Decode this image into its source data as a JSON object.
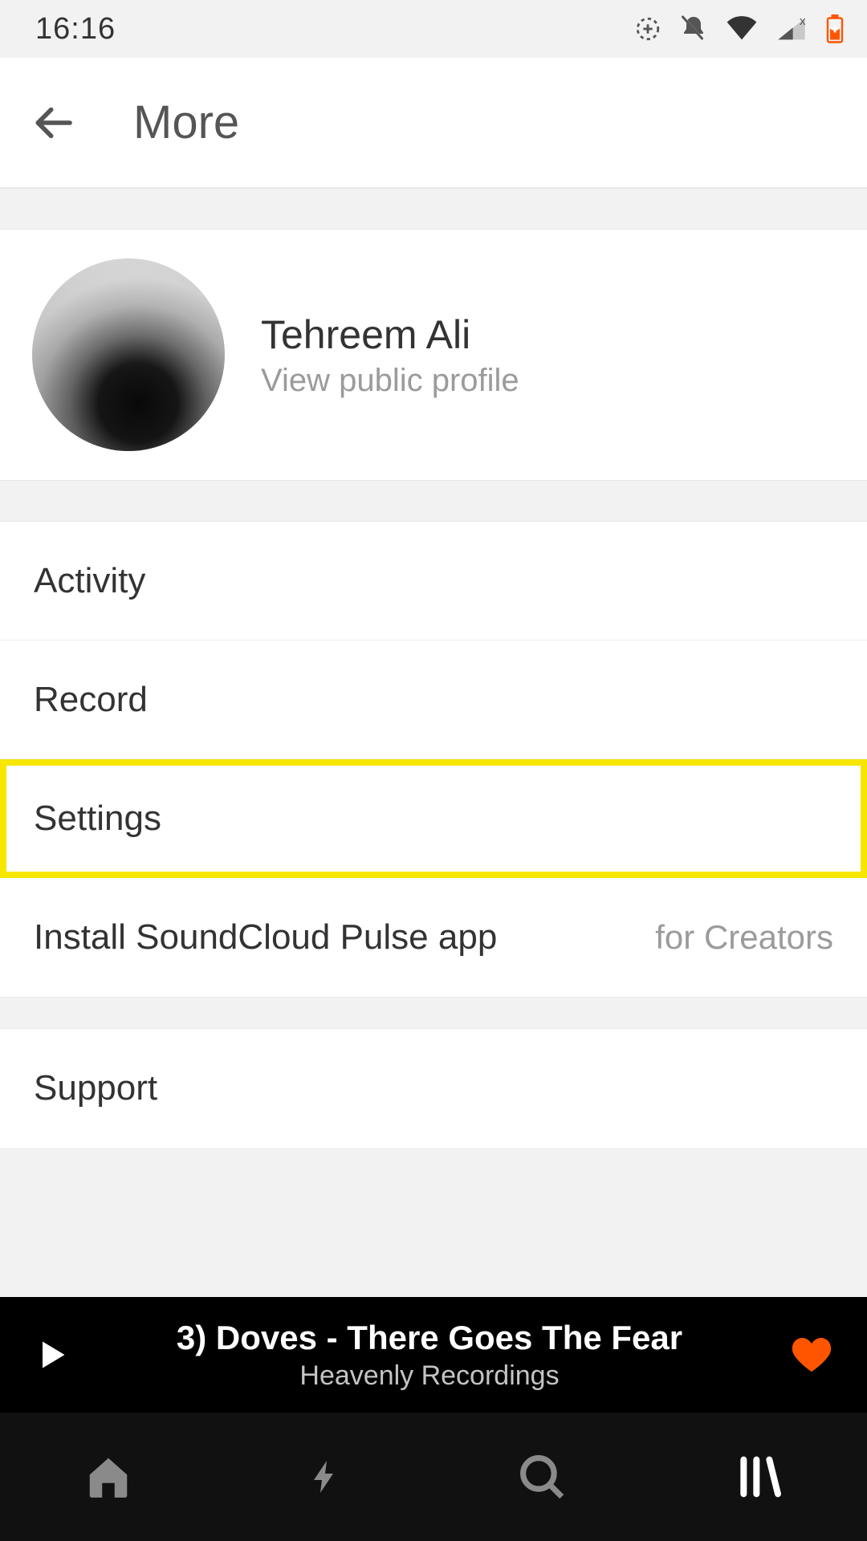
{
  "status": {
    "time": "16:16"
  },
  "header": {
    "title": "More"
  },
  "profile": {
    "name": "Tehreem Ali",
    "subtitle": "View public profile"
  },
  "menu": {
    "items": [
      {
        "label": "Activity"
      },
      {
        "label": "Record"
      },
      {
        "label": "Settings",
        "highlighted": true
      },
      {
        "label": "Install SoundCloud Pulse app",
        "secondary": "for Creators"
      }
    ],
    "support": {
      "label": "Support"
    }
  },
  "player": {
    "title": "3) Doves - There Goes The Fear",
    "artist": "Heavenly Recordings",
    "liked": true
  },
  "nav": {
    "items": [
      "home",
      "stream",
      "search",
      "library"
    ],
    "active": "library"
  },
  "colors": {
    "accent": "#ff5500",
    "highlight": "#f7e600"
  }
}
